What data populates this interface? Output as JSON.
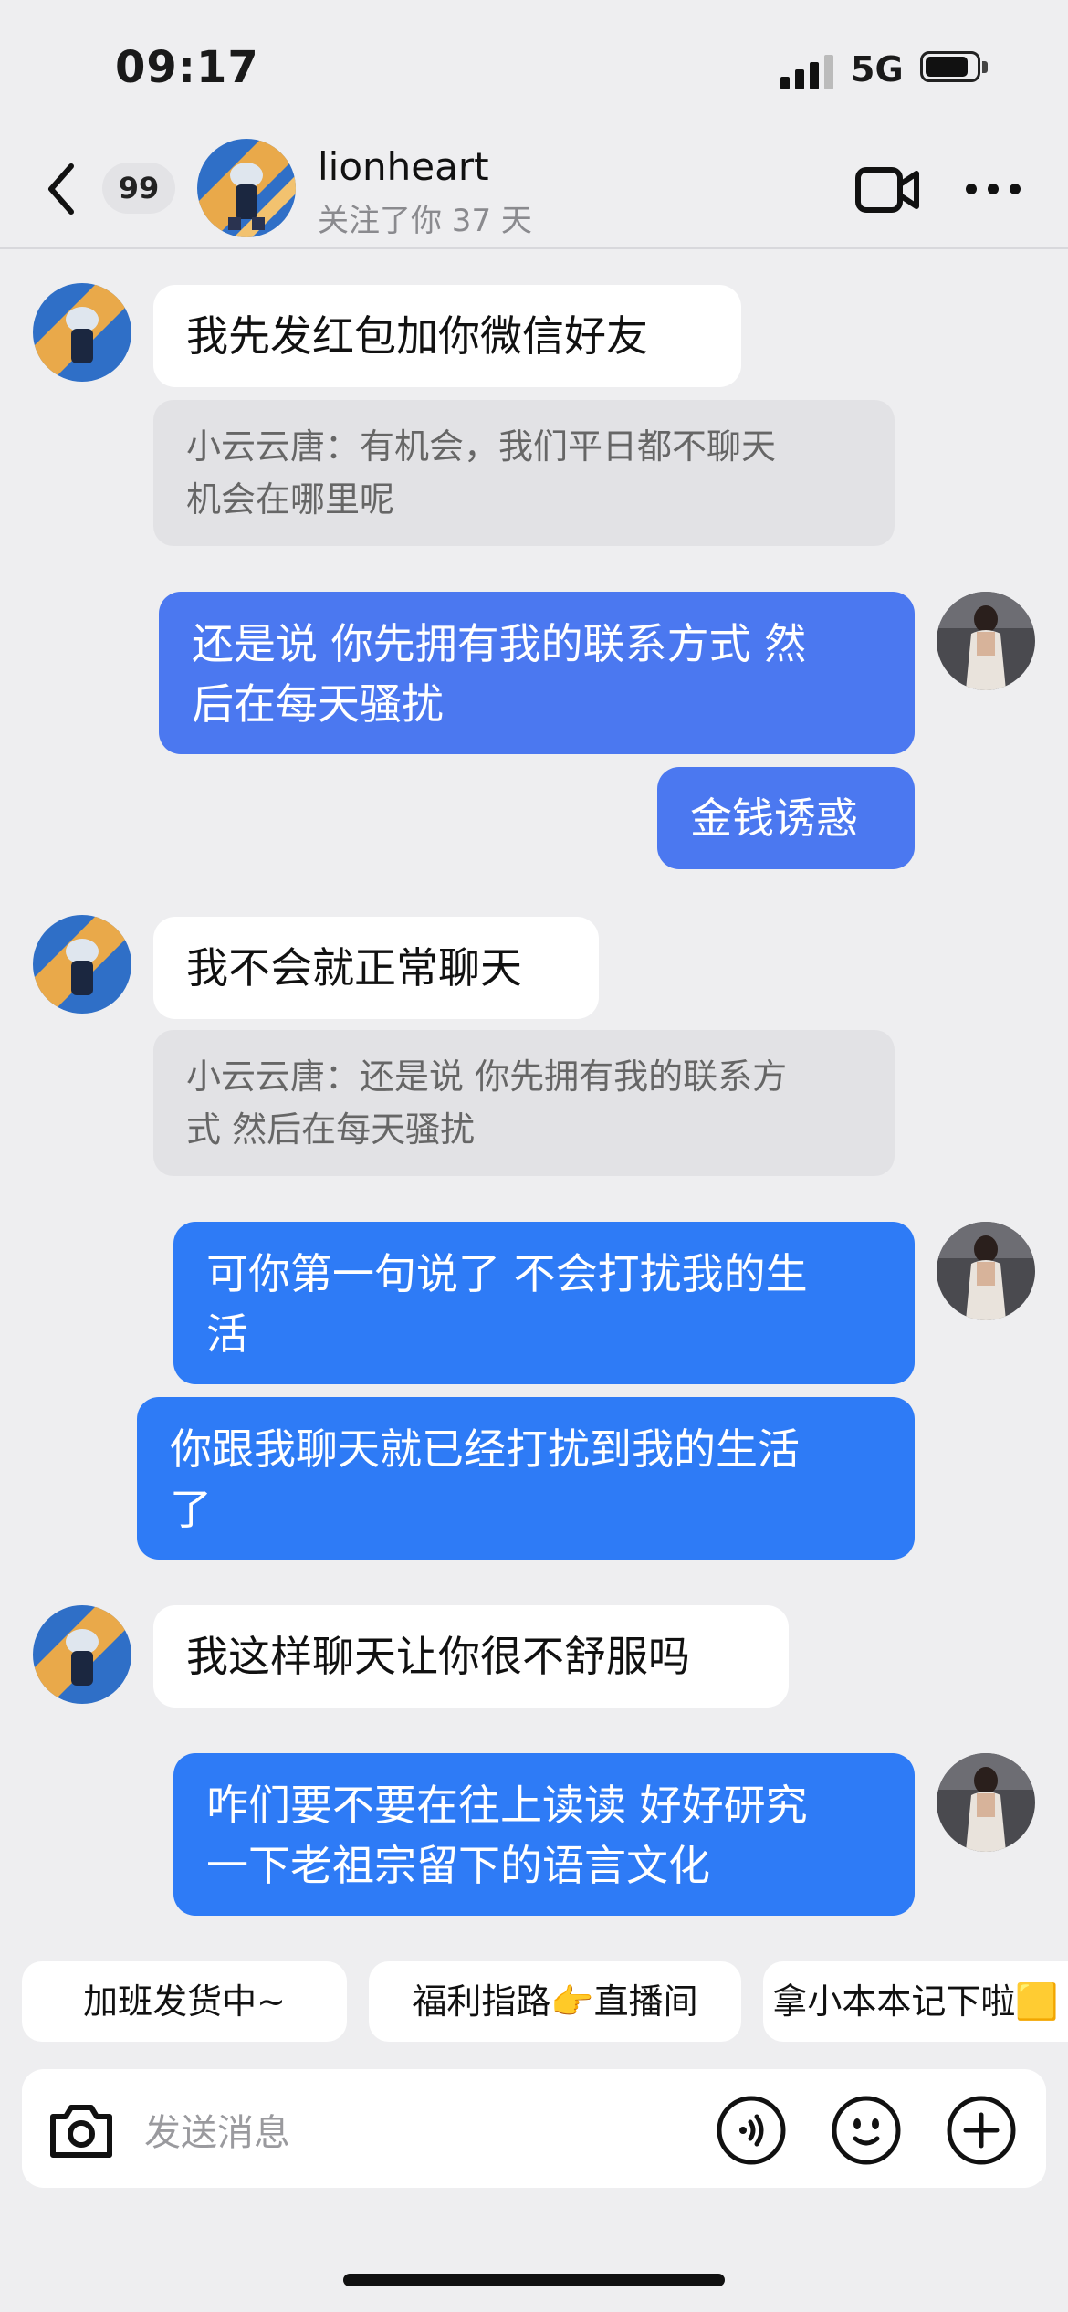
{
  "status_bar": {
    "time": "09:17",
    "network": "5G",
    "battery_level": 0.85
  },
  "header": {
    "unread_count": "99",
    "contact_name": "lionheart",
    "contact_subtitle": "关注了你 37 天"
  },
  "messages": {
    "m1": {
      "text": "我先发红包加你微信好友",
      "quote": "小云云唐：有机会，我们平日都不聊天\n机会在哪里呢"
    },
    "m2": {
      "text": "还是说 你先拥有我的联系方式 然\n后在每天骚扰"
    },
    "m3": {
      "text": "金钱诱惑"
    },
    "m4": {
      "text": "我不会就正常聊天",
      "quote": "小云云唐：还是说 你先拥有我的联系方\n式 然后在每天骚扰"
    },
    "m5": {
      "text": "可你第一句说了 不会打扰我的生\n活"
    },
    "m6": {
      "text": "你跟我聊天就已经打扰到我的生活\n了"
    },
    "m7": {
      "text": "我这样聊天让你很不舒服吗"
    },
    "m8": {
      "text": "咋们要不要在往上读读 好好研究\n一下老祖宗留下的语言文化"
    }
  },
  "quick_replies": [
    "加班发货中~",
    "福利指路👉直播间",
    "拿小本本记下啦🟨"
  ],
  "composer": {
    "placeholder": "发送消息"
  },
  "colors": {
    "bubble_blue_1": "#4b78f0",
    "bubble_blue_2": "#2e7bf6",
    "background": "#eeeef0"
  },
  "icons": [
    "back-chevron-icon",
    "video-call-icon",
    "more-icon",
    "camera-icon",
    "voice-icon",
    "emoji-icon",
    "plus-icon"
  ]
}
